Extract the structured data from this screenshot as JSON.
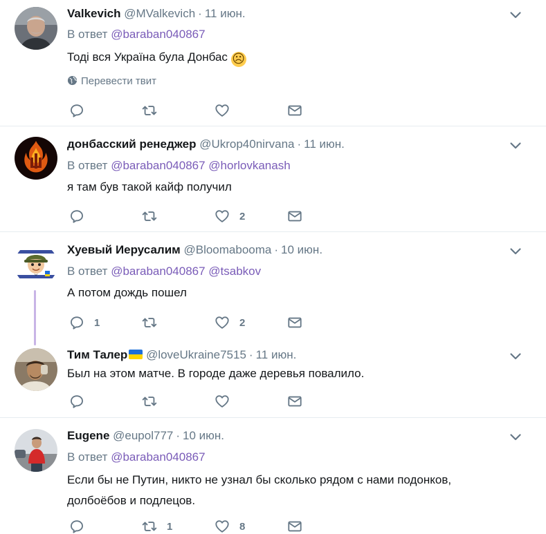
{
  "tweets": [
    {
      "name": "Valkevich",
      "handle": "@MValkevich",
      "time": "11 июн.",
      "reply_prefix": "В ответ",
      "mentions": "@baraban040867",
      "text": "Тоді вся Україна була Донбас",
      "emoji": "☹",
      "translate": "Перевести твит",
      "reply_count": "",
      "retweet_count": "",
      "like_count": ""
    },
    {
      "name": "донбасский ренеджер",
      "handle": "@Ukrop40nirvana",
      "time": "11 июн.",
      "reply_prefix": "В ответ",
      "mentions": "@baraban040867 @horlovkanash",
      "text": "я там був такой кайф получил",
      "reply_count": "",
      "retweet_count": "",
      "like_count": "2"
    },
    {
      "name": "Хуевый Иерусалим",
      "handle": "@Bloomabooma",
      "time": "10 июн.",
      "reply_prefix": "В ответ",
      "mentions": "@baraban040867 @tsabkov",
      "text": "А потом дождь пошел",
      "reply_count": "1",
      "retweet_count": "",
      "like_count": "2"
    },
    {
      "name": "Тим Талер",
      "handle": "@loveUkraine7515",
      "time": "11 июн.",
      "text": "Был на этом матче. В городе даже деревья повалило.",
      "reply_count": "",
      "retweet_count": "",
      "like_count": ""
    },
    {
      "name": "Eugene",
      "handle": "@eupol777",
      "time": "10 июн.",
      "reply_prefix": "В ответ",
      "mentions": "@baraban040867",
      "text_line1": "Если бы не Путин, никто не узнал бы сколько рядом с нами подонков,",
      "text_line2": "долбоёбов и подлецов.",
      "reply_count": "",
      "retweet_count": "1",
      "like_count": "8"
    }
  ],
  "icons": {
    "reply": "reply-icon",
    "retweet": "retweet-icon",
    "like": "heart-icon",
    "dm": "envelope-icon",
    "more": "chevron-down-icon",
    "translate": "globe-icon"
  },
  "colors": {
    "text": "#14171a",
    "muted": "#657786",
    "mention": "#7a5cb8",
    "divider": "#e6ecf0",
    "thread_line": "#c8b4e6"
  }
}
